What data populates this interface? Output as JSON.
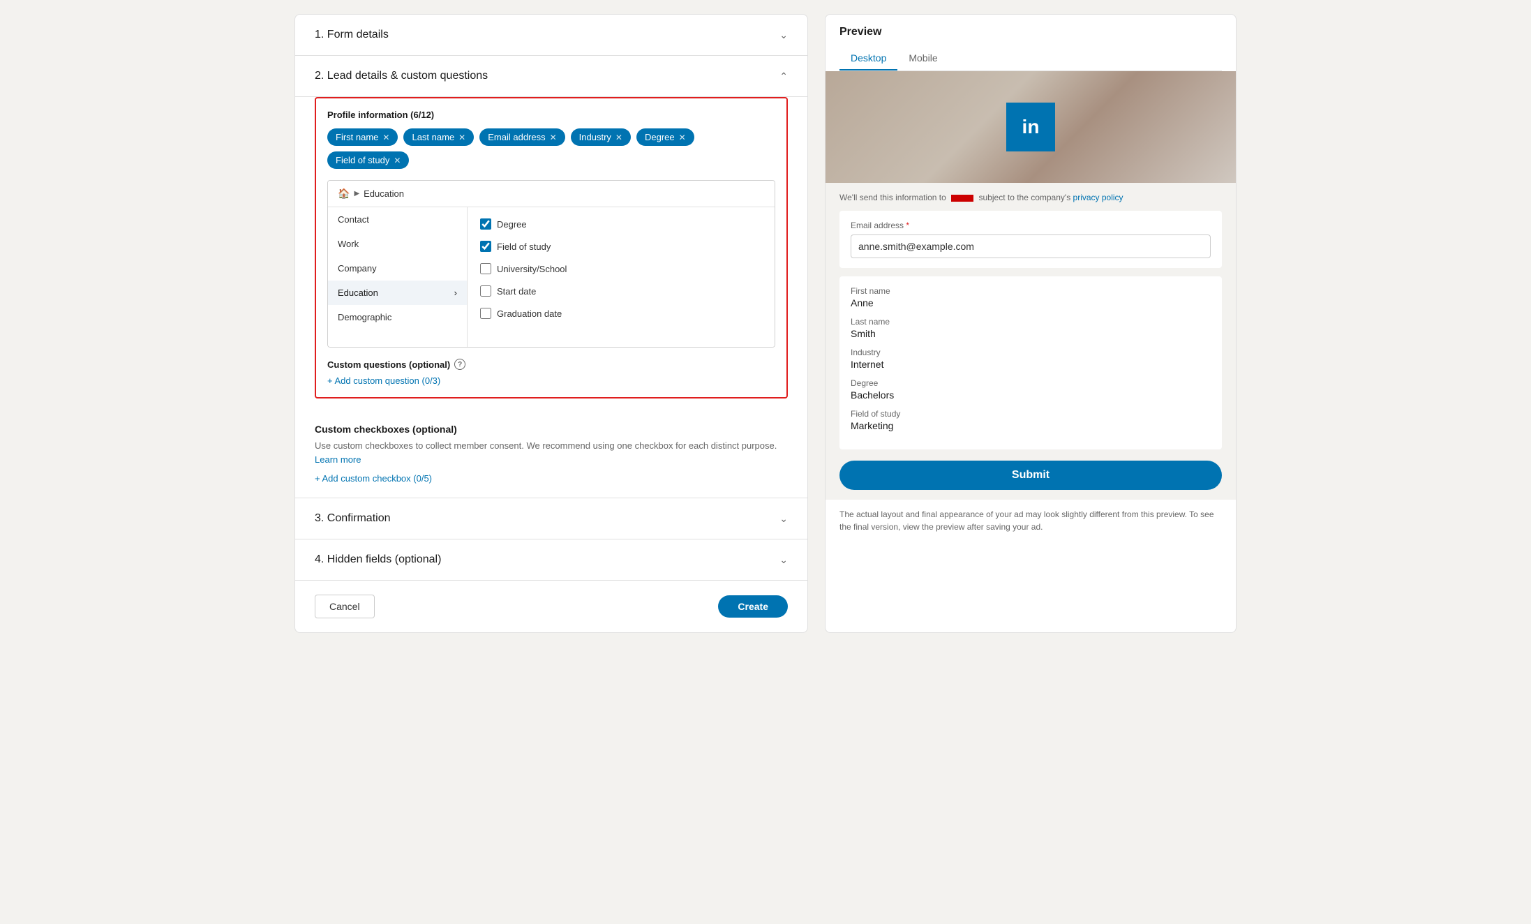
{
  "left_panel": {
    "section1": {
      "title": "1.  Form details",
      "collapsed": true
    },
    "section2": {
      "title": "2.  Lead details & custom questions",
      "collapsed": false
    },
    "profile_info": {
      "title": "Profile information (6/12)",
      "tags": [
        {
          "label": "First name",
          "id": "first-name"
        },
        {
          "label": "Last name",
          "id": "last-name"
        },
        {
          "label": "Email address",
          "id": "email-address"
        },
        {
          "label": "Industry",
          "id": "industry"
        },
        {
          "label": "Degree",
          "id": "degree"
        },
        {
          "label": "Field of study",
          "id": "field-of-study"
        }
      ],
      "tree": {
        "breadcrumb_home": "🏠",
        "breadcrumb_arrow": "▶",
        "breadcrumb_current": "Education",
        "left_items": [
          {
            "label": "Contact",
            "active": false,
            "has_arrow": false
          },
          {
            "label": "Work",
            "active": false,
            "has_arrow": false
          },
          {
            "label": "Company",
            "active": false,
            "has_arrow": false
          },
          {
            "label": "Education",
            "active": true,
            "has_arrow": true
          },
          {
            "label": "Demographic",
            "active": false,
            "has_arrow": false
          }
        ],
        "right_items": [
          {
            "label": "Degree",
            "checked": true
          },
          {
            "label": "Field of study",
            "checked": true
          },
          {
            "label": "University/School",
            "checked": false
          },
          {
            "label": "Start date",
            "checked": false
          },
          {
            "label": "Graduation date",
            "checked": false
          }
        ]
      }
    },
    "custom_questions": {
      "title": "Custom questions (optional)",
      "add_link": "+ Add custom question (0/3)"
    },
    "custom_checkboxes": {
      "title": "Custom checkboxes (optional)",
      "description": "Use custom checkboxes to collect member consent. We recommend using one checkbox for each distinct purpose.",
      "learn_more": "Learn more",
      "add_link": "+ Add custom checkbox (0/5)"
    },
    "section3": {
      "title": "3.  Confirmation"
    },
    "section4": {
      "title": "4.  Hidden fields (optional)"
    },
    "cancel_btn": "Cancel",
    "create_btn": "Create"
  },
  "right_panel": {
    "title": "Preview",
    "tabs": [
      {
        "label": "Desktop",
        "active": true
      },
      {
        "label": "Mobile",
        "active": false
      }
    ],
    "privacy_note_before": "We'll send this information to",
    "privacy_note_after": "subject to the company's",
    "privacy_link": "privacy policy",
    "form": {
      "email_label": "Email address",
      "email_required": "*",
      "email_value": "anne.smith@example.com",
      "fields": [
        {
          "label": "First name",
          "value": "Anne"
        },
        {
          "label": "Last name",
          "value": "Smith"
        },
        {
          "label": "Industry",
          "value": "Internet"
        },
        {
          "label": "Degree",
          "value": "Bachelors"
        },
        {
          "label": "Field of study",
          "value": "Marketing"
        }
      ],
      "submit_btn": "Submit"
    },
    "disclaimer": "The actual layout and final appearance of your ad may look slightly different from this preview. To see the final version, view the preview after saving your ad."
  }
}
